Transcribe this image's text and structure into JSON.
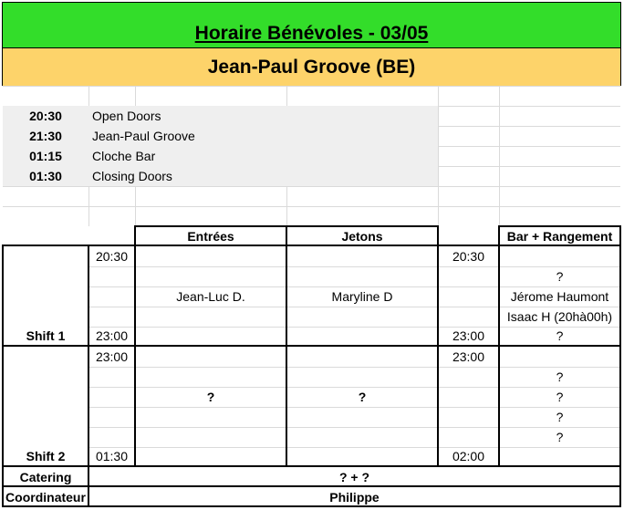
{
  "sheet": {
    "title": "Horaire Bénévoles - 03/05",
    "band": "Jean-Paul Groove (BE)",
    "colors": {
      "title_bg": "#33dd2a",
      "band_bg": "#fdd36a",
      "schedule_bg": "#efefef",
      "gridline": "#dadada"
    }
  },
  "schedule": [
    {
      "time": "20:30",
      "label": "Open Doors"
    },
    {
      "time": "21:30",
      "label": "Jean-Paul Groove"
    },
    {
      "time": "01:15",
      "label": "Cloche Bar"
    },
    {
      "time": "01:30",
      "label": "Closing Doors"
    }
  ],
  "headers": {
    "entrees": "Entrées",
    "jetons": "Jetons",
    "bar": "Bar + Rangement"
  },
  "shift1": {
    "label": "Shift 1",
    "start_left": "20:30",
    "end_left": "23:00",
    "entrees": "Jean-Luc D.",
    "jetons": "Maryline D",
    "start_right": "20:30",
    "end_right": "23:00",
    "bar": [
      "?",
      "Jérome Haumont",
      "Isaac H (20hà00h)",
      "?"
    ]
  },
  "shift2": {
    "label": "Shift 2",
    "start_left": "23:00",
    "end_left": "01:30",
    "entrees": "?",
    "jetons": "?",
    "start_right": "23:00",
    "end_right": "02:00",
    "bar": [
      "?",
      "?",
      "?",
      "?"
    ]
  },
  "catering": {
    "label": "Catering",
    "value": "? + ?"
  },
  "coordinateur": {
    "label": "Coordinateur",
    "value": "Philippe"
  }
}
